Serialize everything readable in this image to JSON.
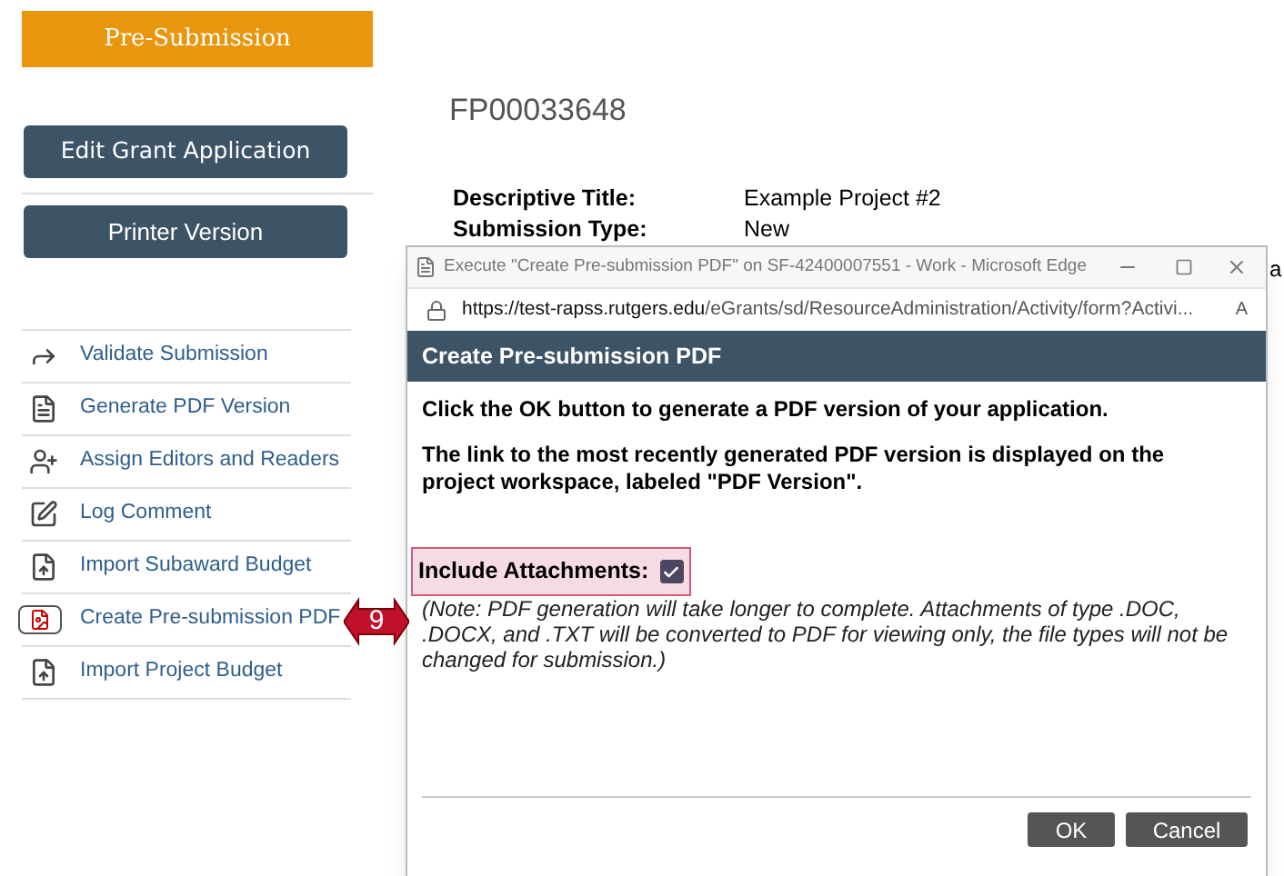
{
  "stage_button": {
    "label": "Pre-Submission"
  },
  "action_buttons": [
    {
      "label": "Edit Grant Application",
      "kind": "edit"
    },
    {
      "label": "Printer Version",
      "kind": "print"
    }
  ],
  "activities": [
    {
      "label": "Validate Submission",
      "kind": "arrow"
    },
    {
      "label": "Generate PDF Version",
      "kind": "pdf"
    },
    {
      "label": "Assign Editors and Readers",
      "kind": "user"
    },
    {
      "label": "Log Comment",
      "kind": "comment"
    },
    {
      "label": "Import Subaward Budget",
      "kind": "import"
    },
    {
      "label": "Create Pre-submission PDF",
      "kind": "pdfbox"
    },
    {
      "label": "Import Project Budget",
      "kind": "import"
    }
  ],
  "project": {
    "id": "FP00033648",
    "fields": [
      {
        "label": "Descriptive Title:",
        "value": "Example Project #2"
      },
      {
        "label": "Submission Type:",
        "value": "New"
      }
    ],
    "hidden_fragment": "a"
  },
  "browser_window": {
    "title": "Execute \"Create Pre-submission PDF\" on SF-42400007551 - Work - Microsoft Edge",
    "url_host": "https://test-rapss.rutgers.edu",
    "url_path": "/eGrants/sd/ResourceAdministration/Activity/form?Activi...",
    "read_aloud": "A"
  },
  "dialog": {
    "title": "Create Pre-submission PDF",
    "paragraphs": [
      "Click the OK button to generate a PDF version of your application.",
      "The link to the most recently generated PDF version is displayed on the project workspace, labeled \"PDF Version\"."
    ],
    "option": {
      "label": "Include Attachments:",
      "checked": true,
      "highlighted": true
    },
    "note": "(Note: PDF generation will take longer to complete. Attachments of type .DOC, .DOCX, and .TXT will be converted to PDF for viewing only, the file types will not be changed for submission.)",
    "buttons": [
      "OK",
      "Cancel"
    ]
  },
  "callout": {
    "number": "9"
  }
}
